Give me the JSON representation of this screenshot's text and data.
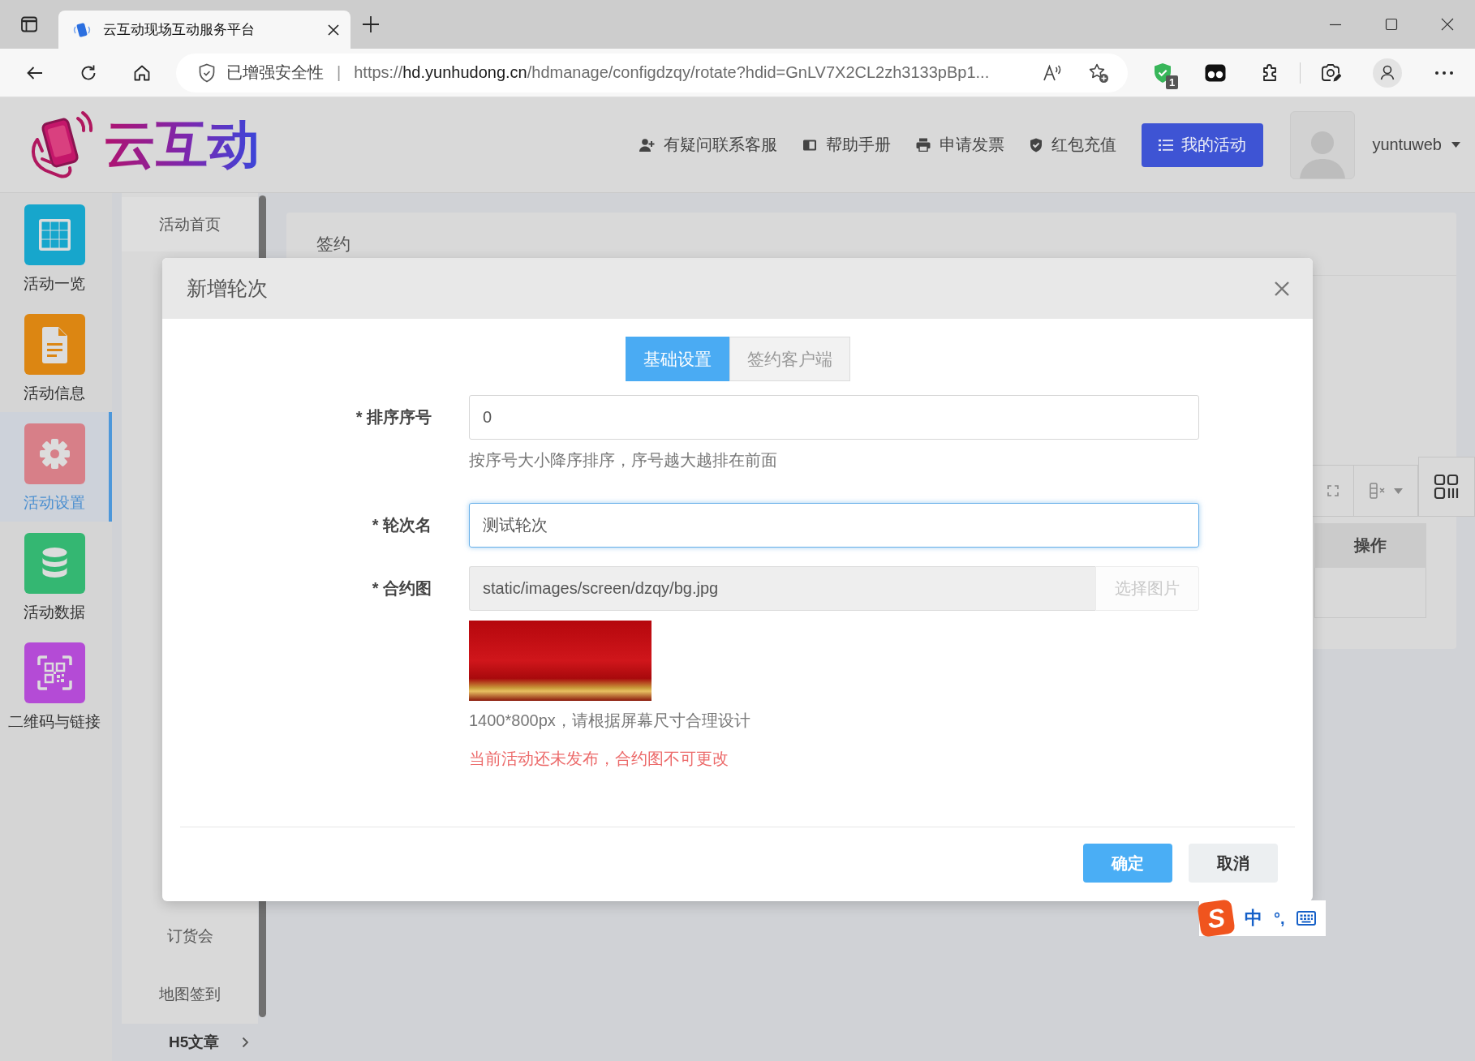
{
  "browser": {
    "tab": {
      "title": "云互动现场互动服务平台"
    },
    "address_bar": {
      "security_label": "已增强安全性",
      "separator": "|",
      "url": {
        "scheme": "https://",
        "host": "hd.yunhudong.cn",
        "rest": "/hdmanage/configdzqy/rotate?hdid=GnLV7X2CL2zh3133pBp1..."
      }
    },
    "extension_badge": "1"
  },
  "header": {
    "logo_text": "云互动",
    "links": [
      {
        "kind": "contact",
        "label": "有疑问联系客服"
      },
      {
        "kind": "manual",
        "label": "帮助手册"
      },
      {
        "kind": "invoice",
        "label": "申请发票"
      },
      {
        "kind": "recharge",
        "label": "红包充值"
      }
    ],
    "primary_button": "我的活动",
    "username": "yuntuweb"
  },
  "sidebar": {
    "items": [
      {
        "kind": "grid",
        "label": "活动一览",
        "color": "#17a6cc",
        "selected": false
      },
      {
        "kind": "document",
        "label": "活动信息",
        "color": "#dc8612",
        "selected": false
      },
      {
        "kind": "gear",
        "label": "活动设置",
        "color": "#d77f88",
        "selected": true
      },
      {
        "kind": "database",
        "label": "活动数据",
        "color": "#34b772",
        "selected": false
      },
      {
        "kind": "qrcode",
        "label": "二维码与链接",
        "color": "#b44bd6",
        "selected": false
      }
    ]
  },
  "subnav": {
    "top_items": [
      {
        "label": "活动首页"
      }
    ],
    "bottom_items": [
      {
        "label": "订货会"
      },
      {
        "label": "地图签到"
      }
    ],
    "group": {
      "label": "H5文章",
      "expandable": true
    }
  },
  "content": {
    "card_title": "签约",
    "table": {
      "columns": [
        {
          "label": "操作"
        }
      ]
    }
  },
  "dialog": {
    "title": "新增轮次",
    "tabs": [
      {
        "label": "基础设置",
        "selected": true
      },
      {
        "label": "签约客户端",
        "selected": false
      }
    ],
    "fields": [
      {
        "kind": "text",
        "label": "* 排序序号",
        "value": "0",
        "focused": false,
        "help": "按序号大小降序排序，序号越大越排在前面"
      },
      {
        "kind": "text",
        "label": "* 轮次名",
        "value": "测试轮次",
        "focused": true
      },
      {
        "kind": "image",
        "label": "* 合约图",
        "value": "static/images/screen/dzqy/bg.jpg",
        "button": {
          "label": "选择图片",
          "disabled": true
        },
        "help": "1400*800px，请根据屏幕尺寸合理设计",
        "warning": "当前活动还未发布，合约图不可更改"
      }
    ],
    "buttons": [
      {
        "kind": "primary",
        "label": "确定"
      },
      {
        "kind": "default",
        "label": "取消"
      }
    ]
  },
  "ime": {
    "logo": "S",
    "mode": "中",
    "punctuation": "°,"
  }
}
